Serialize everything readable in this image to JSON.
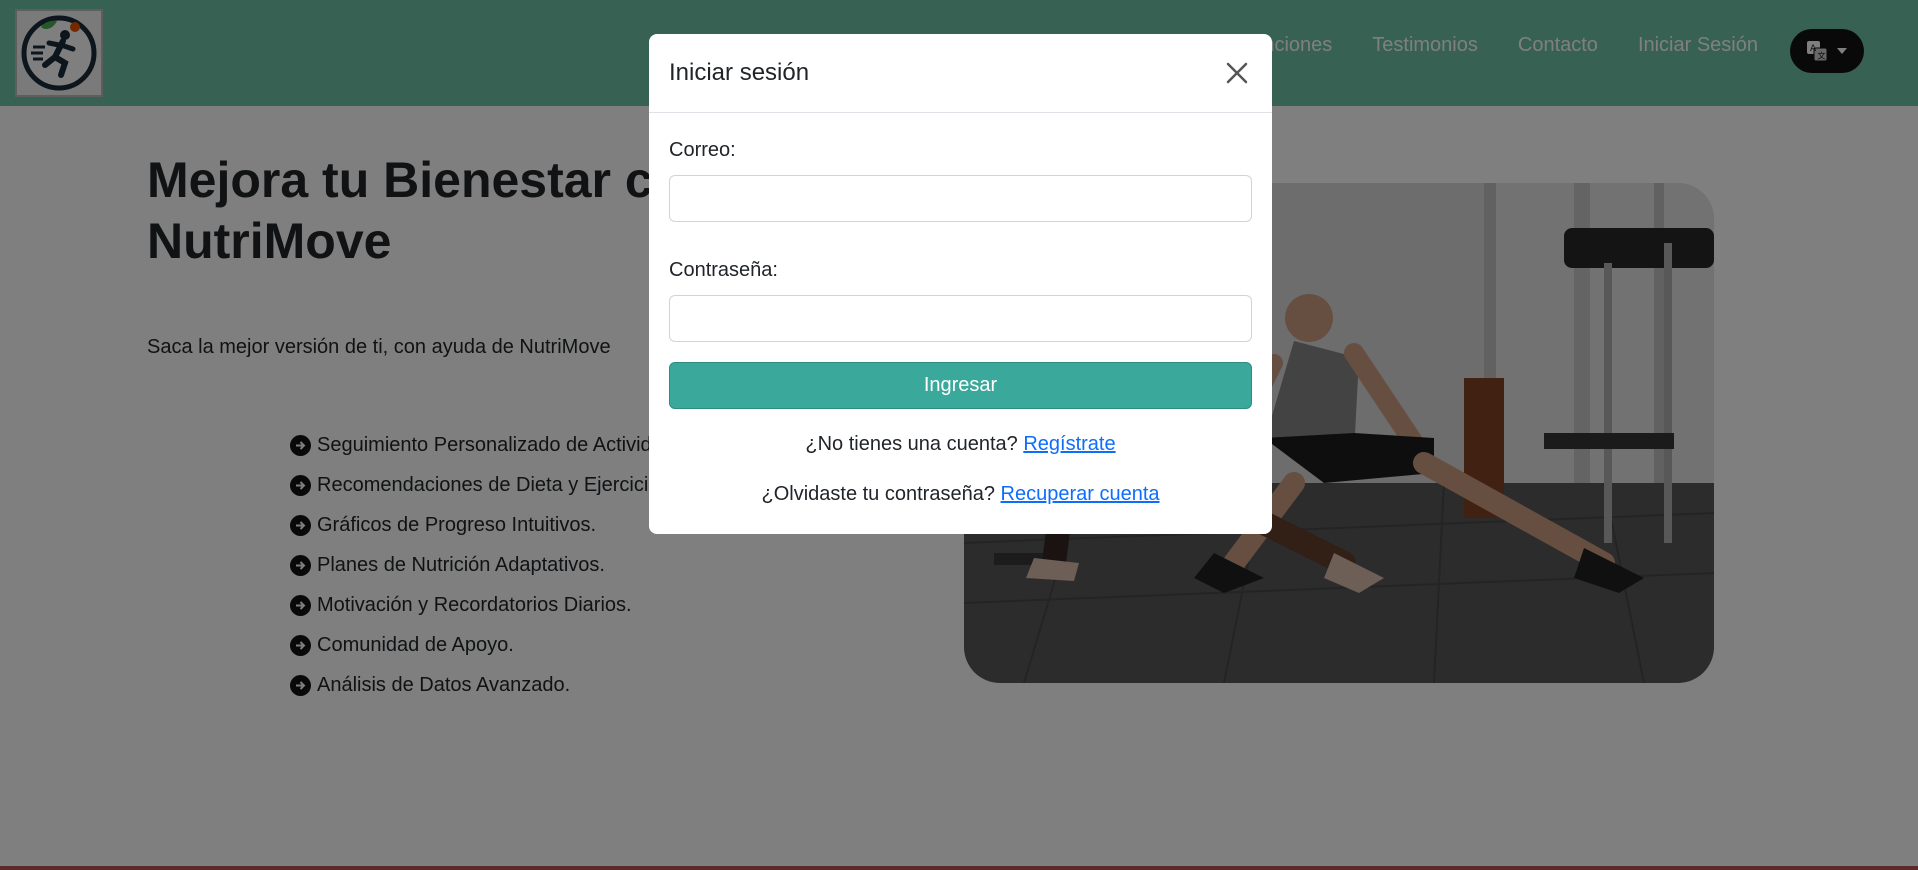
{
  "navbar": {
    "bg_color": "#6ec3a7",
    "links": [
      "Funciones",
      "Testimonios",
      "Contacto",
      "Iniciar Sesión"
    ],
    "language_icon": "translate-icon"
  },
  "hero": {
    "title_line1": "Mejora tu Bienestar con",
    "title_line2": "NutriMove",
    "subtitle": "Saca la mejor versión de ti, con ayuda de NutriMove",
    "features": [
      "Seguimiento Personalizado de Actividad.",
      "Recomendaciones de Dieta y Ejercicio.",
      "Gráficos de Progreso Intuitivos.",
      "Planes de Nutrición Adaptativos.",
      "Motivación y Recordatorios Diarios.",
      "Comunidad de Apoyo.",
      "Análisis de Datos Avanzado."
    ]
  },
  "modal": {
    "title": "Iniciar sesión",
    "email_label": "Correo:",
    "email_value": "",
    "password_label": "Contraseña:",
    "password_value": "",
    "submit_label": "Ingresar",
    "no_account_text": "¿No tienes una cuenta?",
    "register_link": "Regístrate",
    "forgot_text": "¿Olvidaste tu contraseña?",
    "recover_link": "Recuperar cuenta"
  },
  "colors": {
    "accent": "#3ba89c",
    "link": "#0d6efd"
  }
}
